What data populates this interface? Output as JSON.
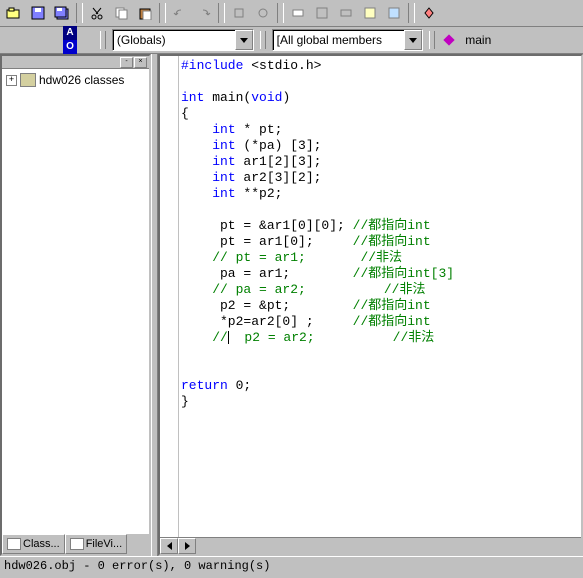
{
  "toolbar2": {
    "badge_a": "A",
    "badge_o": "O",
    "combo1": "(Globals)",
    "combo2": "[All global members",
    "combo3": "main"
  },
  "tree": {
    "root": "hdw026 classes"
  },
  "tabs": {
    "class": "Class...",
    "fileview": "FileVi..."
  },
  "code": {
    "l1a": "#include",
    "l1b": " <stdio.h>",
    "l3a": "int",
    "l3b": " main(",
    "l3c": "void",
    "l3d": ")",
    "l4": "{",
    "l5a": "    ",
    "l5b": "int",
    "l5c": " * pt;",
    "l6a": "    ",
    "l6b": "int",
    "l6c": " (*pa) [3];",
    "l7a": "    ",
    "l7b": "int",
    "l7c": " ar1[2][3];",
    "l8a": "    ",
    "l8b": "int",
    "l8c": " ar2[3][2];",
    "l9a": "    ",
    "l9b": "int",
    "l9c": " **p2;",
    "l11a": "     pt = &ar1[0][0]; ",
    "l11b": "//都指向int",
    "l12a": "     pt = ar1[0];     ",
    "l12b": "//都指向int",
    "l13a": "    ",
    "l13b": "// pt = ar1;       //非法",
    "l14a": "     pa = ar1;        ",
    "l14b": "//都指向int[3]",
    "l15a": "    ",
    "l15b": "// pa = ar2;          //非法",
    "l16a": "     p2 = &pt;        ",
    "l16b": "//都指向int",
    "l17a": "     *p2=ar2[0] ;     ",
    "l17b": "//都指向int",
    "l18a": "    ",
    "l18b": "//",
    "l18c": "  p2 = ar2;          //非法",
    "l21": "return",
    "l21b": " 0;",
    "l22": "}"
  },
  "status": "hdw026.obj - 0 error(s), 0 warning(s)"
}
